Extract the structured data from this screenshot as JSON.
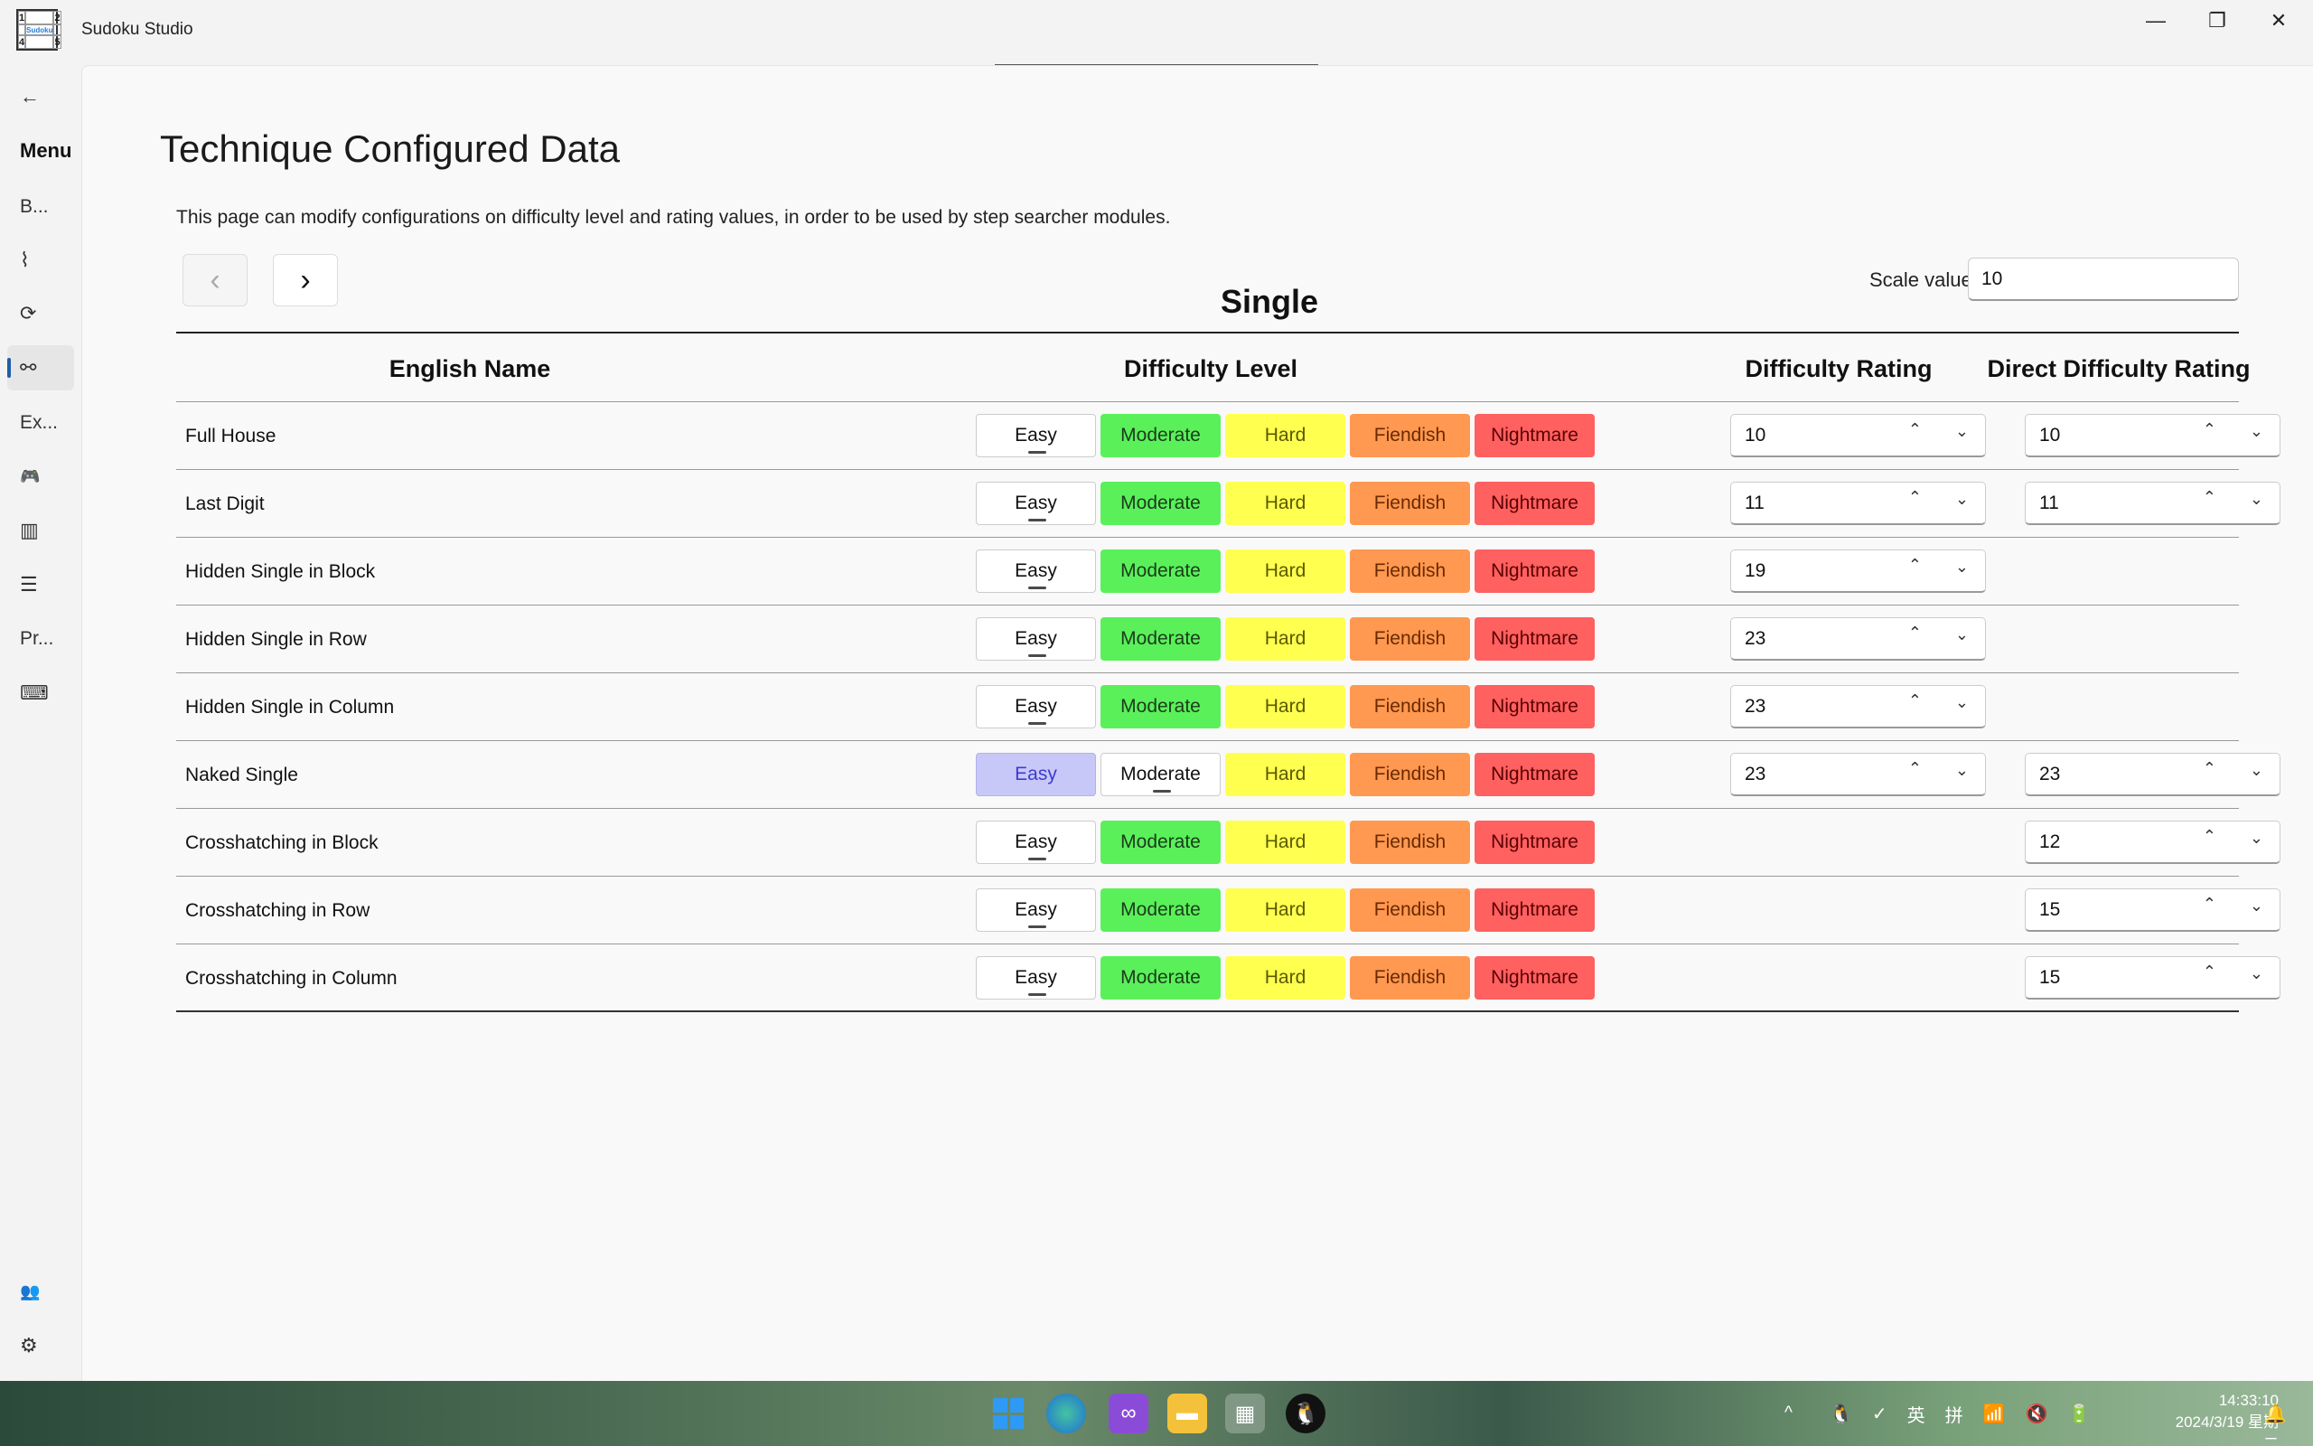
{
  "window": {
    "title": "Sudoku Studio",
    "icon_digits": [
      "1",
      "",
      "2",
      "",
      "Sudoku Studio",
      "",
      "4",
      "",
      "5"
    ],
    "minimize_glyph": "—",
    "maximize_glyph": "❐",
    "close_glyph": "✕"
  },
  "floating_toolbar": {
    "icons": [
      "layout-icon",
      "video-icon",
      "select-icon",
      "frame-icon",
      "tree-icon",
      "hot-reload-icon",
      "accessibility-icon",
      "stop-icon",
      "collapse-icon"
    ],
    "glyphs": [
      "▤",
      "▭",
      "⬚",
      "◻",
      "⊞",
      "⟲",
      "☺",
      "−",
      "‹"
    ]
  },
  "nav": {
    "back_glyph": "←",
    "menu_label": "Menu",
    "items": [
      {
        "label": "B...",
        "icon": "text"
      },
      {
        "label": "",
        "icon": "activity-icon",
        "glyph": "⌇"
      },
      {
        "label": "",
        "icon": "repeat-icon",
        "glyph": "⟳"
      },
      {
        "label": "",
        "icon": "technique-icon",
        "glyph": "⚯",
        "selected": true
      },
      {
        "label": "Ex...",
        "icon": "text"
      },
      {
        "label": "",
        "icon": "gamepad-icon",
        "glyph": "🎮"
      },
      {
        "label": "",
        "icon": "library-icon",
        "glyph": "▥"
      },
      {
        "label": "",
        "icon": "list-icon",
        "glyph": "☰"
      },
      {
        "label": "Pr...",
        "icon": "text"
      },
      {
        "label": "",
        "icon": "keyboard-icon",
        "glyph": "⌨"
      }
    ],
    "bottom": [
      {
        "icon": "people-icon",
        "glyph": "👥"
      },
      {
        "icon": "settings-icon",
        "glyph": "⚙"
      }
    ]
  },
  "page": {
    "title": "Technique Configured Data",
    "description": "This page can modify configurations on difficulty level and rating values, in order to be used by step searcher modules.",
    "prev_glyph": "‹",
    "next_glyph": "›",
    "scale_label": "Scale value:",
    "scale_value": "10",
    "section_title": "Single"
  },
  "table": {
    "headers": {
      "name": "English Name",
      "level": "Difficulty Level",
      "rating": "Difficulty Rating",
      "direct": "Direct Difficulty Rating"
    },
    "level_labels": [
      "Easy",
      "Moderate",
      "Hard",
      "Fiendish",
      "Nightmare"
    ],
    "spin_up": "⌃",
    "spin_down": "⌄",
    "rows": [
      {
        "name": "Full House",
        "selected": "Easy",
        "rating": "10",
        "direct": "10"
      },
      {
        "name": "Last Digit",
        "selected": "Easy",
        "rating": "11",
        "direct": "11"
      },
      {
        "name": "Hidden Single in Block",
        "selected": "Easy",
        "rating": "19",
        "direct": null
      },
      {
        "name": "Hidden Single in Row",
        "selected": "Easy",
        "rating": "23",
        "direct": null
      },
      {
        "name": "Hidden Single in Column",
        "selected": "Easy",
        "rating": "23",
        "direct": null
      },
      {
        "name": "Naked Single",
        "selected": "Moderate",
        "rating": "23",
        "direct": "23"
      },
      {
        "name": "Crosshatching in Block",
        "selected": "Easy",
        "rating": null,
        "direct": "12"
      },
      {
        "name": "Crosshatching in Row",
        "selected": "Easy",
        "rating": null,
        "direct": "15"
      },
      {
        "name": "Crosshatching in Column",
        "selected": "Easy",
        "rating": null,
        "direct": "15"
      }
    ]
  },
  "taskbar": {
    "apps": [
      "start-icon",
      "edge-icon",
      "visual-studio-icon",
      "file-explorer-icon",
      "sudoku-studio-icon",
      "qq-icon"
    ],
    "tray_chevron": "^",
    "tray": [
      "🐧",
      "✓",
      "英",
      "拼",
      "📶",
      "🔇",
      "🔋"
    ],
    "time": "14:33:10",
    "date": "2024/3/19 星期二",
    "bell": "🔔"
  }
}
